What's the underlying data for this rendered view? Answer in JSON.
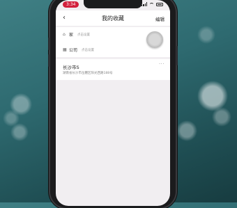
{
  "status_bar": {
    "time": "3:34"
  },
  "nav": {
    "back_icon": "chevron-left-icon",
    "title": "我的收藏",
    "edit": "编辑"
  },
  "quick_places": [
    {
      "icon": "home-icon",
      "label": "家",
      "hint": "点击设置"
    },
    {
      "icon": "company-icon",
      "label": "公司",
      "hint": "点击设置"
    }
  ],
  "favorites": [
    {
      "name": "长沙市S",
      "address": "湖南省长沙市岳麓区阳光西路188号"
    }
  ],
  "colors": {
    "time_pill": "#d21f3c",
    "screen_bg": "#f1eef1"
  }
}
